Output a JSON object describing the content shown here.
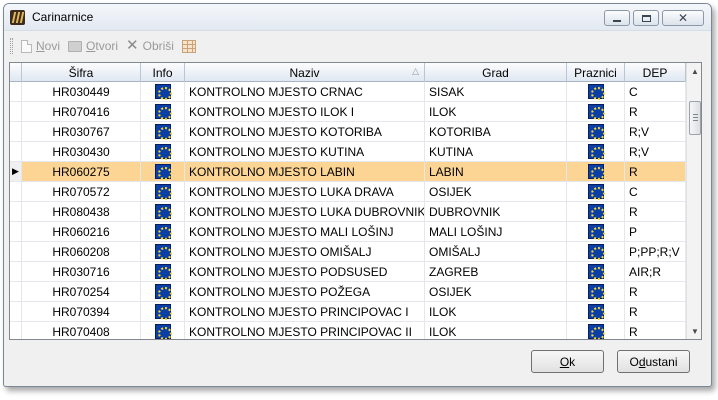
{
  "window": {
    "title": "Carinarnice",
    "icon": "app-icon"
  },
  "toolbar": {
    "new_label": "Novi",
    "new_accel": "N",
    "new_rest": "ovi",
    "open_label": "Otvori",
    "open_accel": "O",
    "open_rest": "tvori",
    "delete_label": "Obriši",
    "icons": [
      "new-document-icon",
      "open-folder-icon",
      "delete-x-icon",
      "grid-layout-icon"
    ]
  },
  "table": {
    "columns": [
      "Šifra",
      "Info",
      "Naziv",
      "Grad",
      "Praznici",
      "DEP"
    ],
    "sorted_column": "Naziv",
    "selected_row": 4,
    "rows": [
      {
        "sifra": "HR030449",
        "naziv": "KONTROLNO MJESTO CRNAC",
        "grad": "SISAK",
        "dep": "C"
      },
      {
        "sifra": "HR070416",
        "naziv": "KONTROLNO MJESTO ILOK I",
        "grad": "ILOK",
        "dep": "R"
      },
      {
        "sifra": "HR030767",
        "naziv": "KONTROLNO MJESTO KOTORIBA",
        "grad": "KOTORIBA",
        "dep": "R;V"
      },
      {
        "sifra": "HR030430",
        "naziv": "KONTROLNO MJESTO KUTINA",
        "grad": "KUTINA",
        "dep": "R;V"
      },
      {
        "sifra": "HR060275",
        "naziv": "KONTROLNO MJESTO LABIN",
        "grad": "LABIN",
        "dep": "R"
      },
      {
        "sifra": "HR070572",
        "naziv": "KONTROLNO MJESTO LUKA DRAVA",
        "grad": "OSIJEK",
        "dep": "C"
      },
      {
        "sifra": "HR080438",
        "naziv": "KONTROLNO MJESTO LUKA DUBROVNIK",
        "grad": "DUBROVNIK",
        "dep": "R"
      },
      {
        "sifra": "HR060216",
        "naziv": "KONTROLNO MJESTO MALI LOŠINJ",
        "grad": "MALI LOŠINJ",
        "dep": "P"
      },
      {
        "sifra": "HR060208",
        "naziv": "KONTROLNO MJESTO OMIŠALJ",
        "grad": "OMIŠALJ",
        "dep": "P;PP;R;V"
      },
      {
        "sifra": "HR030716",
        "naziv": "KONTROLNO MJESTO PODSUSED",
        "grad": "ZAGREB",
        "dep": "AIR;R"
      },
      {
        "sifra": "HR070254",
        "naziv": "KONTROLNO MJESTO POŽEGA",
        "grad": "OSIJEK",
        "dep": "R"
      },
      {
        "sifra": "HR070394",
        "naziv": "KONTROLNO MJESTO PRINCIPOVAC I",
        "grad": "ILOK",
        "dep": "R"
      },
      {
        "sifra": "HR070408",
        "naziv": "KONTROLNO MJESTO PRINCIPOVAC II",
        "grad": "ILOK",
        "dep": "R"
      }
    ]
  },
  "buttons": {
    "ok_accel": "O",
    "ok_rest": "k",
    "cancel_pre": "O",
    "cancel_accel": "d",
    "cancel_rest": "ustani"
  },
  "colors": {
    "selected_row": "#fcd594",
    "flag_blue": "#0b3fa5",
    "flag_stars": "#f7d62b"
  }
}
